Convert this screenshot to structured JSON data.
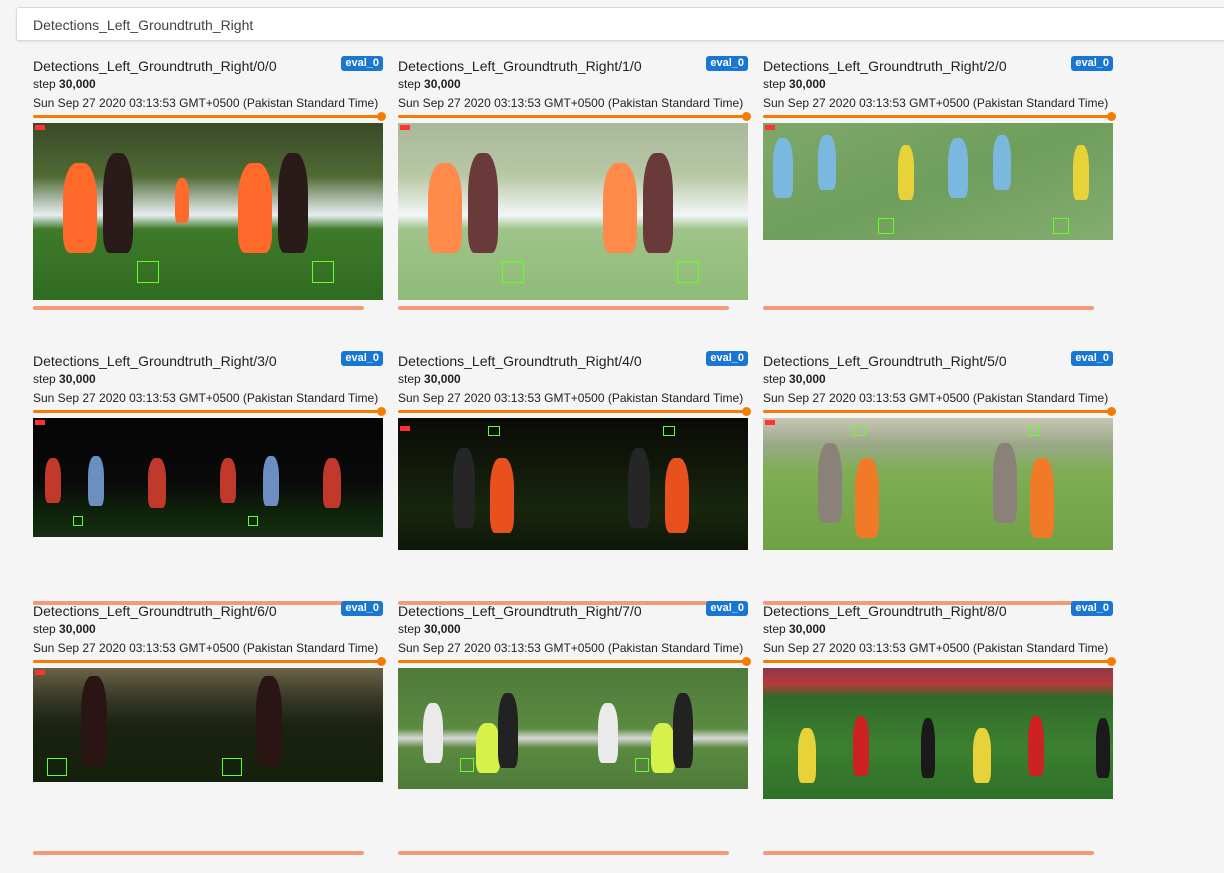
{
  "header": {
    "title": "Detections_Left_Groundtruth_Right"
  },
  "cards": [
    {
      "title": "Detections_Left_Groundtruth_Right/0/0",
      "run": "eval_0",
      "step_label": "step",
      "step_value": "30,000",
      "timestamp": "Sun Sep 27 2020 03:13:53 GMT+0500 (Pakistan Standard Time)",
      "image_subject": "women's soccer players, orange and red-black kits"
    },
    {
      "title": "Detections_Left_Groundtruth_Right/1/0",
      "run": "eval_0",
      "step_label": "step",
      "step_value": "30,000",
      "timestamp": "Sun Sep 27 2020 03:13:53 GMT+0500 (Pakistan Standard Time)",
      "image_subject": "women's soccer players, brightened"
    },
    {
      "title": "Detections_Left_Groundtruth_Right/2/0",
      "run": "eval_0",
      "step_label": "step",
      "step_value": "30,000",
      "timestamp": "Sun Sep 27 2020 03:13:53 GMT+0500 (Pakistan Standard Time)",
      "image_subject": "kids soccer, blue and yellow shirts"
    },
    {
      "title": "Detections_Left_Groundtruth_Right/3/0",
      "run": "eval_0",
      "step_label": "step",
      "step_value": "30,000",
      "timestamp": "Sun Sep 27 2020 03:13:53 GMT+0500 (Pakistan Standard Time)",
      "image_subject": "night soccer, red and blue kits"
    },
    {
      "title": "Detections_Left_Groundtruth_Right/4/0",
      "run": "eval_0",
      "step_label": "step",
      "step_value": "30,000",
      "timestamp": "Sun Sep 27 2020 03:13:53 GMT+0500 (Pakistan Standard Time)",
      "image_subject": "dark soccer match, orange kit"
    },
    {
      "title": "Detections_Left_Groundtruth_Right/5/0",
      "run": "eval_0",
      "step_label": "step",
      "step_value": "30,000",
      "timestamp": "Sun Sep 27 2020 03:13:53 GMT+0500 (Pakistan Standard Time)",
      "image_subject": "soccer match, orange and grey kits"
    },
    {
      "title": "Detections_Left_Groundtruth_Right/6/0",
      "run": "eval_0",
      "step_label": "step",
      "step_value": "30,000",
      "timestamp": "Sun Sep 27 2020 03:13:53 GMT+0500 (Pakistan Standard Time)",
      "image_subject": "dark stadium soccer player"
    },
    {
      "title": "Detections_Left_Groundtruth_Right/7/0",
      "run": "eval_0",
      "step_label": "step",
      "step_value": "30,000",
      "timestamp": "Sun Sep 27 2020 03:13:53 GMT+0500 (Pakistan Standard Time)",
      "image_subject": "goalkeeper in yellow, player in green and white"
    },
    {
      "title": "Detections_Left_Groundtruth_Right/8/0",
      "run": "eval_0",
      "step_label": "step",
      "step_value": "30,000",
      "timestamp": "Sun Sep 27 2020 03:13:53 GMT+0500 (Pakistan Standard Time)",
      "image_subject": "professional stadium soccer match"
    }
  ],
  "colors": {
    "accent": "#f57c00",
    "badge": "#1976d2",
    "bottom_bar": "#f29b77",
    "detection_box": "#66ff22"
  }
}
